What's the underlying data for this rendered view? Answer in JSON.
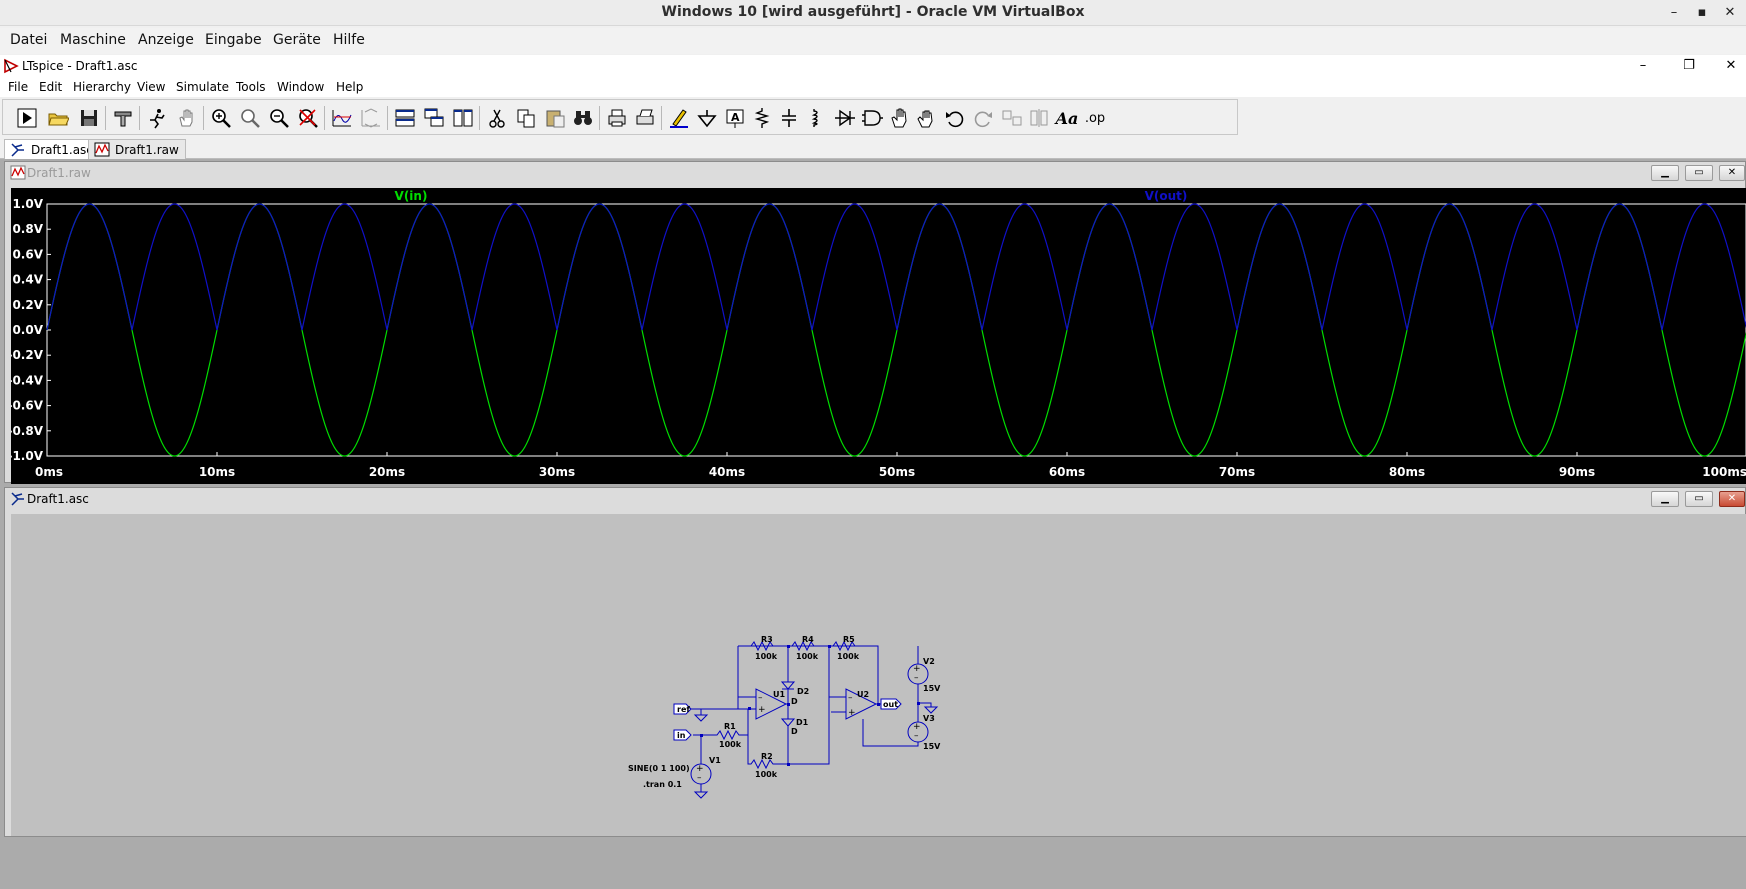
{
  "vbox": {
    "title": "Windows 10 [wird ausgeführt] - Oracle VM VirtualBox",
    "controls": {
      "minimize": "–",
      "maximize": "▪",
      "close": "✕"
    },
    "menu": [
      "Datei",
      "Maschine",
      "Anzeige",
      "Eingabe",
      "Geräte",
      "Hilfe"
    ]
  },
  "ltspice": {
    "title": "LTspice - Draft1.asc",
    "menu": [
      "File",
      "Edit",
      "Hierarchy",
      "View",
      "Simulate",
      "Tools",
      "Window",
      "Help"
    ],
    "toolbar_icons": [
      "run-icon",
      "open-icon",
      "save-icon",
      "control-panel-icon",
      "probe-run-icon",
      "pan-hand-icon",
      "zoom-in-icon",
      "zoom-area-icon",
      "zoom-out-icon",
      "zoom-cancel-icon",
      "autorange-icon",
      "vertical-autorange-icon",
      "tile-horizontal-icon",
      "cascade-icon",
      "tile-vertical-icon",
      "cut-icon",
      "copy-icon",
      "paste-icon",
      "find-icon",
      "print-icon",
      "print-setup-icon",
      "draw-wire-icon",
      "ground-icon",
      "label-net-icon",
      "resistor-icon",
      "capacitor-icon",
      "inductor-icon",
      "diode-icon",
      "component-icon",
      "move-icon",
      "drag-icon",
      "undo-icon",
      "redo-icon",
      "rotate-icon",
      "mirror-icon",
      "text-icon",
      "spice-directive-icon"
    ],
    "toolbar_texts": {
      "text": "Aa",
      "op": ".op"
    },
    "tabs": [
      {
        "label": "Draft1.asc",
        "icon": "schematic-icon",
        "active": true
      },
      {
        "label": "Draft1.raw",
        "icon": "waveform-icon",
        "active": false
      }
    ]
  },
  "waveform_window": {
    "title": "Draft1.raw",
    "controls": {
      "minimize": "▁",
      "maximize": "▭",
      "close": "✕"
    },
    "colors": {
      "background": "#000000",
      "vin": "#00dd00",
      "vout": "#1010c8",
      "axis": "#ffffff"
    }
  },
  "chart_data": {
    "type": "line",
    "xlabel": "",
    "ylabel": "",
    "x_ticks": [
      "0ms",
      "10ms",
      "20ms",
      "30ms",
      "40ms",
      "50ms",
      "60ms",
      "70ms",
      "80ms",
      "90ms",
      "100ms"
    ],
    "y_ticks": [
      "1.0V",
      "0.8V",
      "0.6V",
      "0.4V",
      "0.2V",
      "0.0V",
      "-0.2V",
      "-0.4V",
      "-0.6V",
      "-0.8V",
      "-1.0V"
    ],
    "xlim": [
      0,
      100
    ],
    "ylim": [
      -1.0,
      1.0
    ],
    "series": [
      {
        "name": "V(in)",
        "function": "sine",
        "amplitude": 1.0,
        "frequency_hz": 100,
        "offset": 0
      },
      {
        "name": "V(out)",
        "function": "abs_sine",
        "amplitude": 1.0,
        "frequency_hz": 100,
        "offset": 0
      }
    ]
  },
  "schematic_window": {
    "title": "Draft1.asc",
    "controls": {
      "minimize": "▁",
      "maximize": "▭",
      "close": "✕"
    },
    "labels": {
      "r3": "R3",
      "r3v": "100k",
      "r4": "R4",
      "r4v": "100k",
      "r5": "R5",
      "r5v": "100k",
      "r1": "R1",
      "r1v": "100k",
      "r2": "R2",
      "r2v": "100k",
      "d1": "D1",
      "d1v": "D",
      "d2": "D2",
      "d2v": "D",
      "u1": "U1",
      "u2": "U2",
      "v1": "V1",
      "v2": "V2",
      "v2v": "15V",
      "v3": "V3",
      "v3v": "15V",
      "ref": "ref",
      "in": "in",
      "out": "out",
      "sine": "SINE(0 1 100)",
      "tran": ".tran 0.1"
    }
  }
}
